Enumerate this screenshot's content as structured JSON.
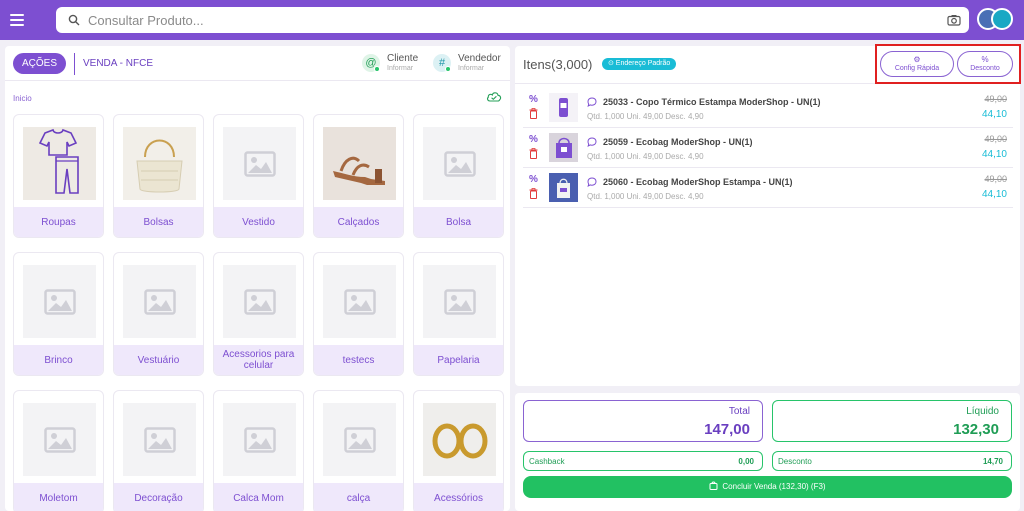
{
  "search": {
    "placeholder": "Consultar Produto..."
  },
  "left": {
    "actions_label": "AÇÕES",
    "sale_title": "VENDA - NFCE",
    "client": {
      "name": "Cliente",
      "sub": "Informar"
    },
    "seller": {
      "name": "Vendedor",
      "sub": "Informar"
    },
    "breadcrumb": "Inicio",
    "categories": [
      {
        "label": "Roupas",
        "image": "clothes-outline"
      },
      {
        "label": "Bolsas",
        "image": "handbag-photo"
      },
      {
        "label": "Vestido",
        "image": "placeholder"
      },
      {
        "label": "Calçados",
        "image": "sandal-photo"
      },
      {
        "label": "Bolsa",
        "image": "placeholder"
      },
      {
        "label": "Brinco",
        "image": "placeholder"
      },
      {
        "label": "Vestuário",
        "image": "placeholder"
      },
      {
        "label": "Acessorios para celular",
        "image": "placeholder"
      },
      {
        "label": "testecs",
        "image": "placeholder"
      },
      {
        "label": "Papelaria",
        "image": "placeholder"
      },
      {
        "label": "Moletom",
        "image": "placeholder"
      },
      {
        "label": "Decoração",
        "image": "placeholder"
      },
      {
        "label": "Calca Mom",
        "image": "placeholder"
      },
      {
        "label": "calça",
        "image": "placeholder"
      },
      {
        "label": "Acessórios",
        "image": "earrings-photo"
      }
    ]
  },
  "right": {
    "items_title": "Itens(3,000)",
    "address_badge": "⊙ Endereço Padrão",
    "config_label": "Config Rápida",
    "discount_label": "Desconto",
    "items": [
      {
        "name": "25033 - Copo Térmico Estampa ModerShop - UN(1)",
        "meta": "Qtd. 1,000  Uni. 49,00  Desc. 4,90",
        "old_price": "49,00",
        "new_price": "44,10"
      },
      {
        "name": "25059 - Ecobag ModerShop - UN(1)",
        "meta": "Qtd. 1,000  Uni. 49,00  Desc. 4,90",
        "old_price": "49,00",
        "new_price": "44,10"
      },
      {
        "name": "25060 - Ecobag ModerShop Estampa - UN(1)",
        "meta": "Qtd. 1,000  Uni. 49,00  Desc. 4,90",
        "old_price": "49,00",
        "new_price": "44,10"
      }
    ]
  },
  "totals": {
    "total_label": "Total",
    "total_value": "147,00",
    "net_label": "Líquido",
    "net_value": "132,30",
    "cashback_label": "Cashback",
    "cashback_value": "0,00",
    "discount_label": "Desconto",
    "discount_value": "14,70",
    "finish_label": "Concluir Venda (132,30) (F3)"
  },
  "colors": {
    "brand": "#7d4fd1",
    "accent": "#19bcd6",
    "success": "#22c162",
    "highlight": "#e02020"
  }
}
